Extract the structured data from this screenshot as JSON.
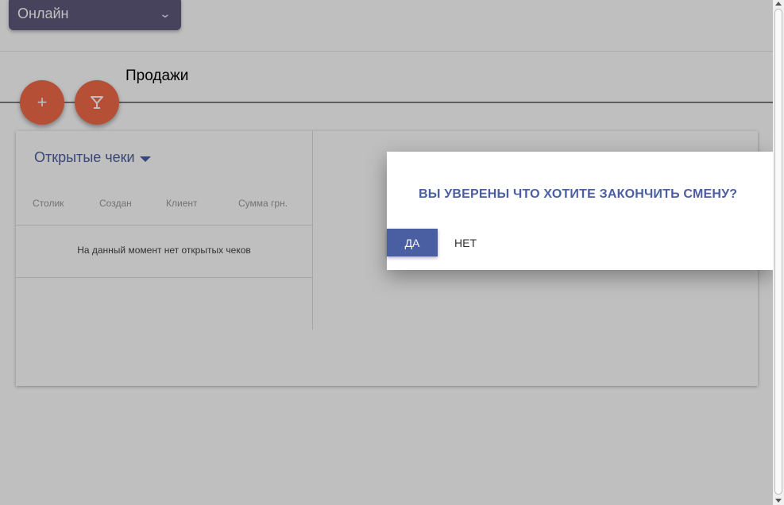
{
  "status_select": {
    "value": "Онлайн"
  },
  "page": {
    "title": "Продажи"
  },
  "fab": {
    "add_label": "+"
  },
  "open_checks": {
    "title": "Открытые чеки",
    "columns": [
      "Столик",
      "Создан",
      "Клиент",
      "Сумма грн."
    ],
    "empty_message": "На данный момент нет открытых чеков"
  },
  "dialog": {
    "title": "ВЫ УВЕРЕНЫ ЧТО ХОТИТЕ ЗАКОНЧИТЬ СМЕНУ?",
    "yes_label": "ДА",
    "no_label": "НЕТ"
  },
  "colors": {
    "accent": "#4a5fa1",
    "fab": "#f26b4a",
    "select_bg": "#5f5a7d"
  },
  "icons": [
    "chevron-down-icon",
    "plus-icon",
    "cocktail-glass-icon",
    "caret-down-icon"
  ]
}
